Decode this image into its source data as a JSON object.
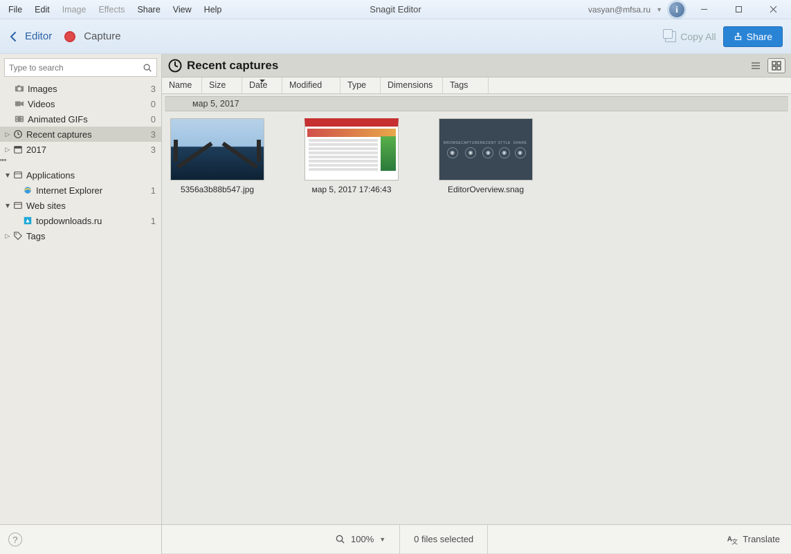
{
  "app_title": "Snagit Editor",
  "menubar": [
    "File",
    "Edit",
    "Image",
    "Effects",
    "Share",
    "View",
    "Help"
  ],
  "menubar_disabled": [
    2,
    3
  ],
  "user_email": "vasyan@mfsa.ru",
  "switchbar": {
    "editor": "Editor",
    "capture": "Capture",
    "copy_all": "Copy All",
    "share": "Share"
  },
  "search_placeholder": "Type to search",
  "tree": {
    "images": {
      "label": "Images",
      "count": "3"
    },
    "videos": {
      "label": "Videos",
      "count": "0"
    },
    "gifs": {
      "label": "Animated GIFs",
      "count": "0"
    },
    "recent": {
      "label": "Recent captures",
      "count": "3"
    },
    "year": {
      "label": "2017",
      "count": "3"
    },
    "apps": {
      "label": "Applications"
    },
    "ie": {
      "label": "Internet Explorer",
      "count": "1"
    },
    "web": {
      "label": "Web sites"
    },
    "topdl": {
      "label": "topdownloads.ru",
      "count": "1"
    },
    "tags": {
      "label": "Tags"
    }
  },
  "main_heading": "Recent captures",
  "columns": {
    "name": "Name",
    "size": "Size",
    "date": "Date",
    "modified": "Modified",
    "type": "Type",
    "dimensions": "Dimensions",
    "tags": "Tags"
  },
  "group_date": "мар 5, 2017",
  "thumbs": {
    "t1": "5356a3b88b547.jpg",
    "t2": "мар 5, 2017 17:46:43",
    "t3": "EditorOverview.snag"
  },
  "overview_labels": [
    "BROWSE",
    "CAPTURE",
    "RECENT",
    "STYLE",
    "SHARE"
  ],
  "status": {
    "zoom": "100%",
    "selection": "0 files selected",
    "translate": "Translate"
  }
}
